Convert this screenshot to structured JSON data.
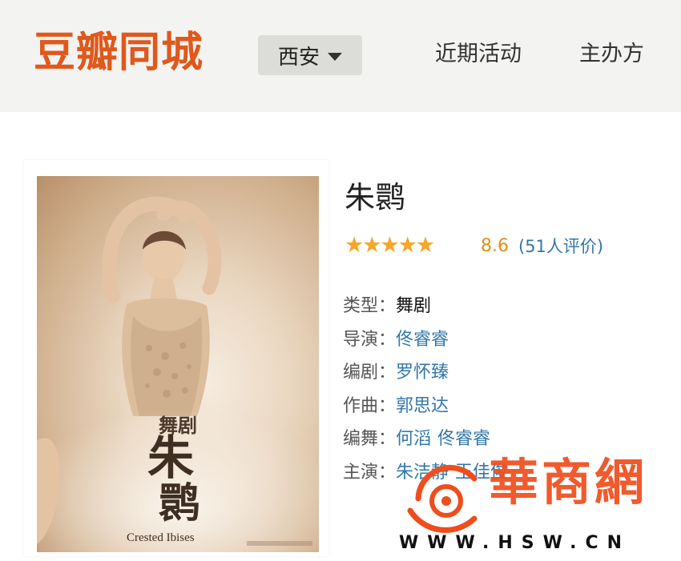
{
  "header": {
    "logo": "豆瓣同城",
    "city": "西安",
    "nav": [
      "近期活动",
      "主办方"
    ]
  },
  "poster": {
    "tag": "舞剧",
    "title_line1": "朱",
    "title_line2": "鹮",
    "english_title": "Crested Ibises"
  },
  "event": {
    "title": "朱鹮",
    "rating": {
      "stars": "★★★★★",
      "value": 4.5,
      "max": 5,
      "score": "8.6",
      "votes": "(51人评价)"
    },
    "info": [
      {
        "key": "类型：",
        "values": [
          "舞剧"
        ],
        "link": false
      },
      {
        "key": "导演：",
        "values": [
          "佟睿睿"
        ],
        "link": true
      },
      {
        "key": "编剧：",
        "values": [
          "罗怀臻"
        ],
        "link": true
      },
      {
        "key": "作曲：",
        "values": [
          "郭思达"
        ],
        "link": true
      },
      {
        "key": "编舞：",
        "values": [
          "何滔",
          "佟睿睿"
        ],
        "link": true
      },
      {
        "key": "主演：",
        "values": [
          "朱洁静",
          "王佳俊"
        ],
        "link": true
      }
    ]
  },
  "watermark": {
    "text": "華商網",
    "url": "WWW.HSW.CN"
  },
  "colors": {
    "brand": "#e0581c",
    "star": "#f7a625",
    "link": "#3377aa",
    "watermark": "#ef4d1c"
  }
}
